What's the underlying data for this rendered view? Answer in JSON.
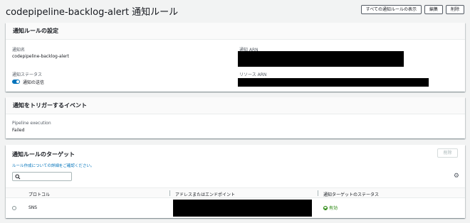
{
  "page": {
    "title": "codepipeline-backlog-alert 通知ルール",
    "buttons": {
      "view_all": "すべての通知ルールの表示",
      "edit": "編集",
      "delete": "削除"
    }
  },
  "settings": {
    "title": "通知ルールの設定",
    "name_label": "通知名",
    "name_value": "codepipeline-backlog-alert",
    "arn_label": "通知 ARN",
    "status_label": "通知ステータス",
    "status_value": "通知の送信",
    "resource_arn_label": "リソース ARN"
  },
  "triggers": {
    "title": "通知をトリガーするイベント",
    "event_label": "Pipeline execution",
    "event_value": "Failed"
  },
  "targets": {
    "title": "通知ルールのターゲット",
    "delete_label": "削除",
    "help_link": "ルール作成についての詳細をご確認ください。",
    "search_placeholder": "",
    "columns": [
      "プロトコル",
      "アドレスまたはエンドポイント",
      "通知ターゲットのステータス"
    ],
    "rows": [
      {
        "protocol": "SNS",
        "status": "有効"
      }
    ]
  },
  "colors": {
    "accent": "#0073bb",
    "status_ok": "#1d8102",
    "redaction": "#000000"
  },
  "icons": [
    "search-icon",
    "gear-icon",
    "check-circle-icon",
    "toggle-icon"
  ]
}
